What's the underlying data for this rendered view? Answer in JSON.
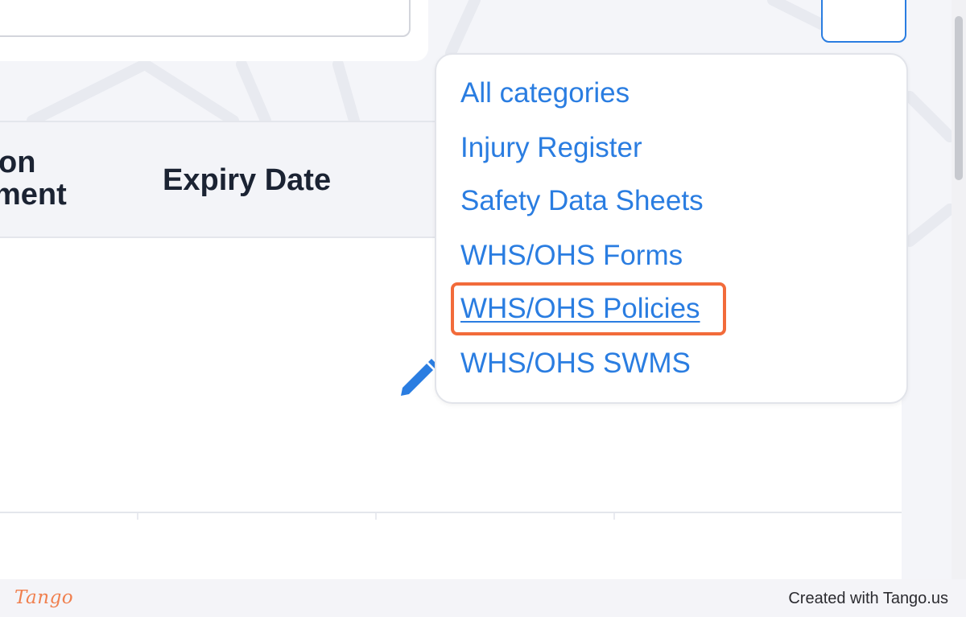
{
  "dropdown": {
    "items": [
      {
        "label": "All categories"
      },
      {
        "label": "Injury Register"
      },
      {
        "label": "Safety Data Sheets"
      },
      {
        "label": "WHS/OHS Forms"
      },
      {
        "label": "WHS/OHS Policies"
      },
      {
        "label": "WHS/OHS SWMS"
      }
    ],
    "highlighted_item": "WHS/OHS Policies"
  },
  "table": {
    "columns": [
      {
        "line1": "on",
        "line2": "ment"
      },
      {
        "label": "Expiry Date"
      }
    ]
  },
  "footer": {
    "logo_text": "Tango",
    "credit": "Created with Tango.us"
  },
  "colors": {
    "accent": "#2a7de1",
    "highlight": "#f26b3a",
    "heading_text": "#1b2333",
    "tango_brand": "#f0804f"
  }
}
